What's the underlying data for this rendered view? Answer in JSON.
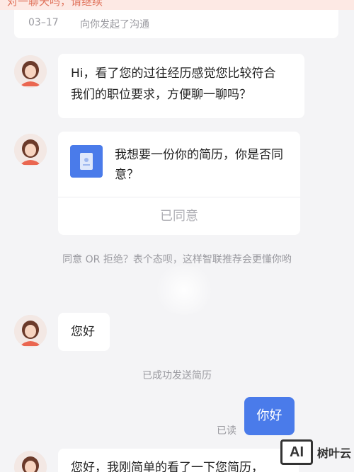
{
  "banner": {
    "text": "对一聊天吗，请继续"
  },
  "session": {
    "date": "03–17",
    "desc": "向你发起了沟通"
  },
  "messages": {
    "m1_line1": "Hi，看了您的过往经历感觉您比较符合",
    "m1_line2": "我们的职位要求，方便聊一聊吗？",
    "m2_line1": "我想要一份你的简历，你是否同",
    "m2_line2": "意？",
    "m2_button": "已同意",
    "note_agree": "同意 OR 拒绝？表个态呗，这样智联推荐会更懂你哟",
    "m3_text": "您好",
    "note_sent": "已成功发送简历",
    "my_reply": "你好",
    "my_reply_status": "已读",
    "m4_text": "您好，我刚简单的看了一下您简历，"
  },
  "watermark": {
    "logo": "AI",
    "text": "树叶云"
  },
  "icons": {
    "avatar": "avatar-icon",
    "doc": "resume-doc-icon"
  },
  "colors": {
    "accent": "#4a7bea",
    "background": "#f4f4f6",
    "muted": "#9a9aa0"
  }
}
